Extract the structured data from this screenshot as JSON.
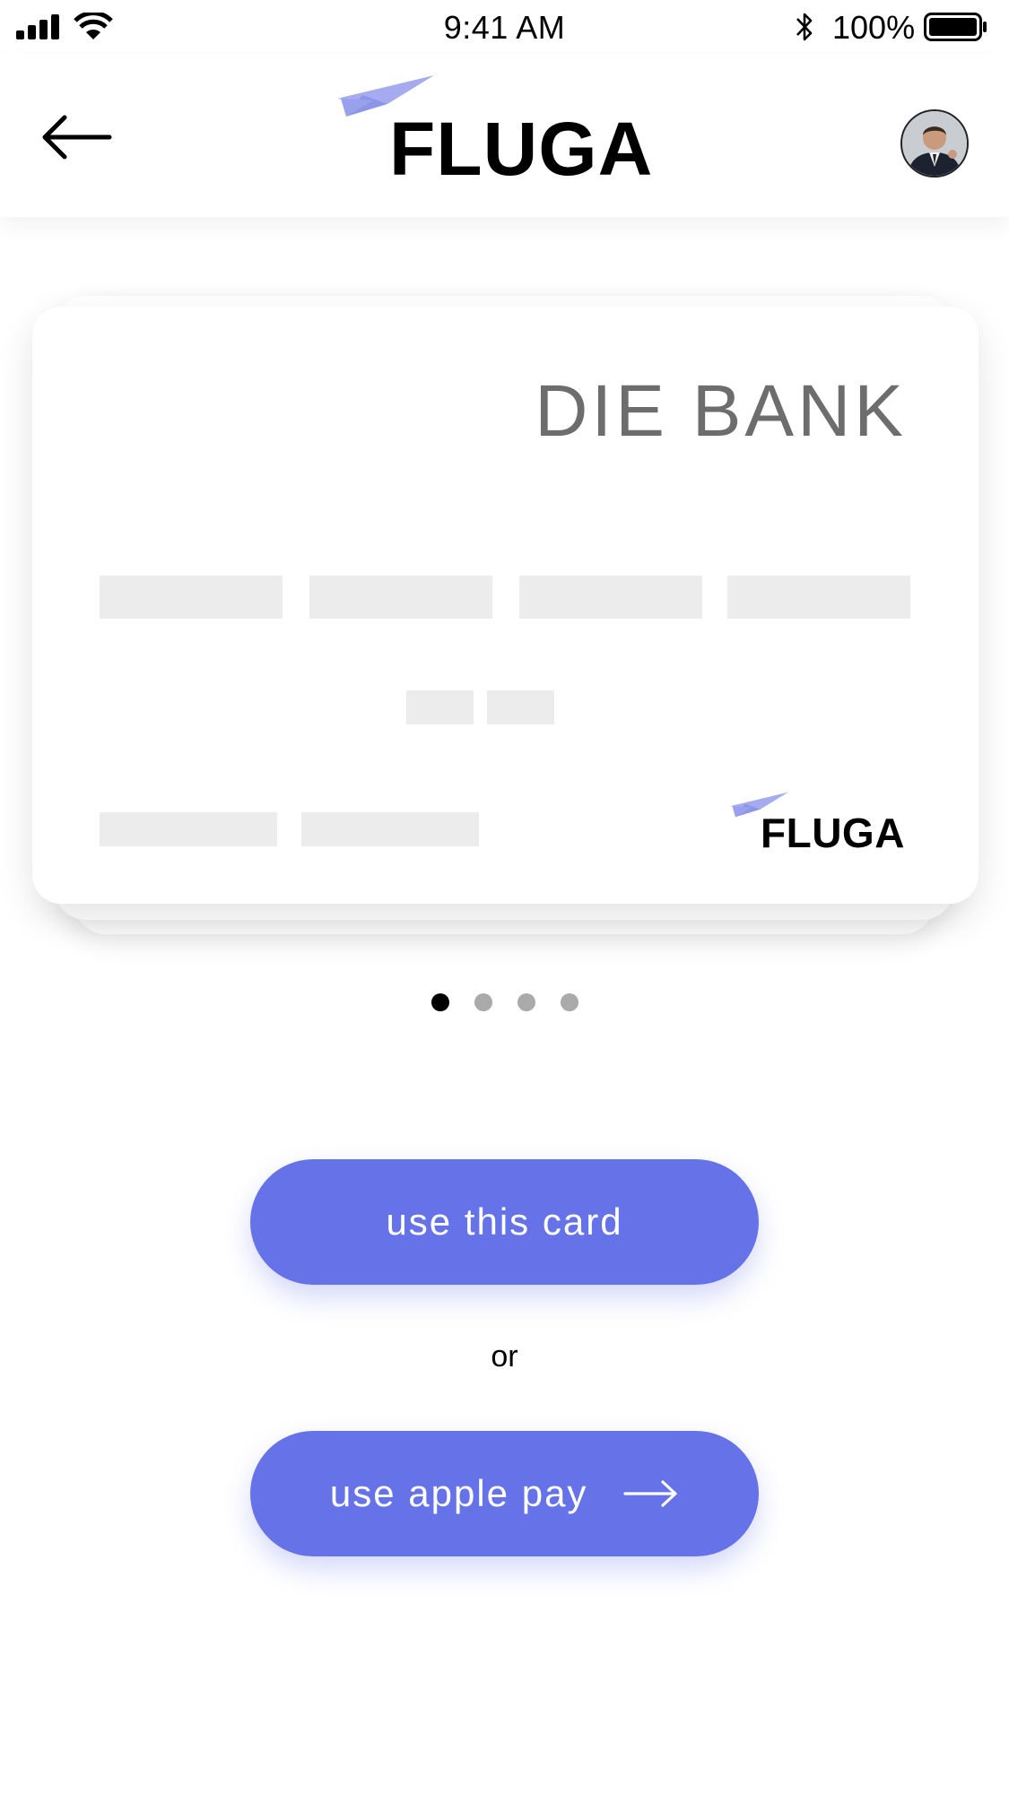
{
  "status_bar": {
    "time": "9:41 AM",
    "battery_percent": "100%",
    "signal_icon": "signal-icon",
    "wifi_icon": "wifi-icon",
    "bluetooth_icon": "bluetooth-icon",
    "battery_icon": "battery-icon",
    "battery_level": 1.0
  },
  "header": {
    "back_icon": "arrow-left-icon",
    "logo_text": "FLUGA",
    "logo_icon": "paper-plane-icon",
    "avatar_icon": "user-avatar"
  },
  "card": {
    "bank_name": "DIE BANK",
    "brand_text": "FLUGA",
    "brand_icon": "paper-plane-icon"
  },
  "pager": {
    "count": 4,
    "active_index": 0
  },
  "actions": {
    "use_card_label": "use this card",
    "or_label": "or",
    "apple_pay_label": "use apple pay",
    "apple_pay_icon": "arrow-right-icon"
  },
  "colors": {
    "accent": "#6673E8",
    "logo_plane": "#A5ABEE",
    "placeholder": "#ECECEC",
    "bank_text": "#6D6D6D",
    "dot_inactive": "#AAAAAA",
    "dot_active": "#000000"
  }
}
